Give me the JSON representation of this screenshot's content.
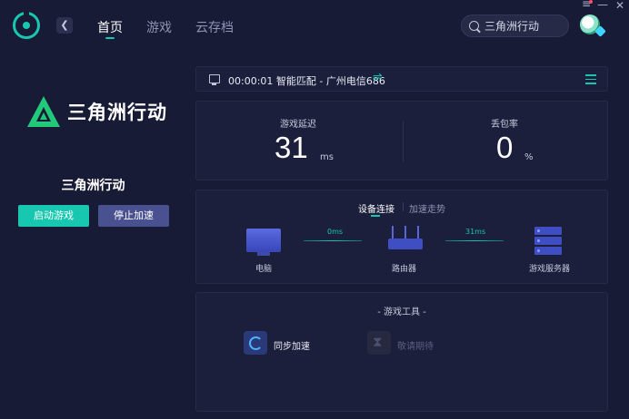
{
  "topbar": {
    "nav_tabs": [
      {
        "label": "首页",
        "active": true
      },
      {
        "label": "游戏",
        "active": false
      },
      {
        "label": "云存档",
        "active": false
      }
    ],
    "search_value": "三角洲行动",
    "window_controls": {
      "menu": "≡",
      "minimize": "—",
      "close": "✕"
    }
  },
  "left_panel": {
    "logo_text": "三角洲行动",
    "game_name": "三角洲行动",
    "start_label": "启动游戏",
    "stop_label": "停止加速"
  },
  "status": {
    "text": "00:00:01  智能匹配 - 广州电信686",
    "swap_icon": "⇌"
  },
  "stats": {
    "latency_label": "游戏延迟",
    "latency_value": "31",
    "latency_unit": "ms",
    "loss_label": "丢包率",
    "loss_value": "0",
    "loss_unit": "%"
  },
  "network": {
    "tabs": [
      "设备连接",
      "加速走势"
    ],
    "devices": [
      "电脑",
      "路由器",
      "游戏服务器"
    ],
    "links": [
      "0ms",
      "31ms"
    ]
  },
  "tools": {
    "title": "- 游戏工具 -",
    "items": [
      "同步加速",
      "敬请期待"
    ]
  },
  "colors": {
    "accent": "#17c7b0",
    "background": "#181b36",
    "card": "#1c1f3b",
    "stop_button": "#4a5190"
  }
}
